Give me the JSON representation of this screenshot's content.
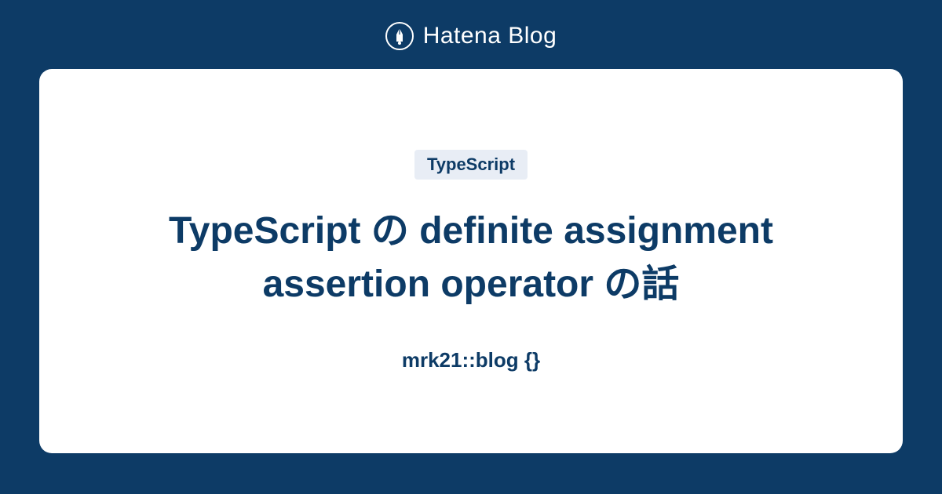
{
  "header": {
    "brand_text": "Hatena Blog"
  },
  "card": {
    "tag": "TypeScript",
    "title": "TypeScript の definite assignment assertion operator の話",
    "author": "mrk21::blog {}"
  },
  "colors": {
    "background": "#0d3b66",
    "card_bg": "#ffffff",
    "tag_bg": "#e8edf5",
    "text_primary": "#0d3b66"
  }
}
